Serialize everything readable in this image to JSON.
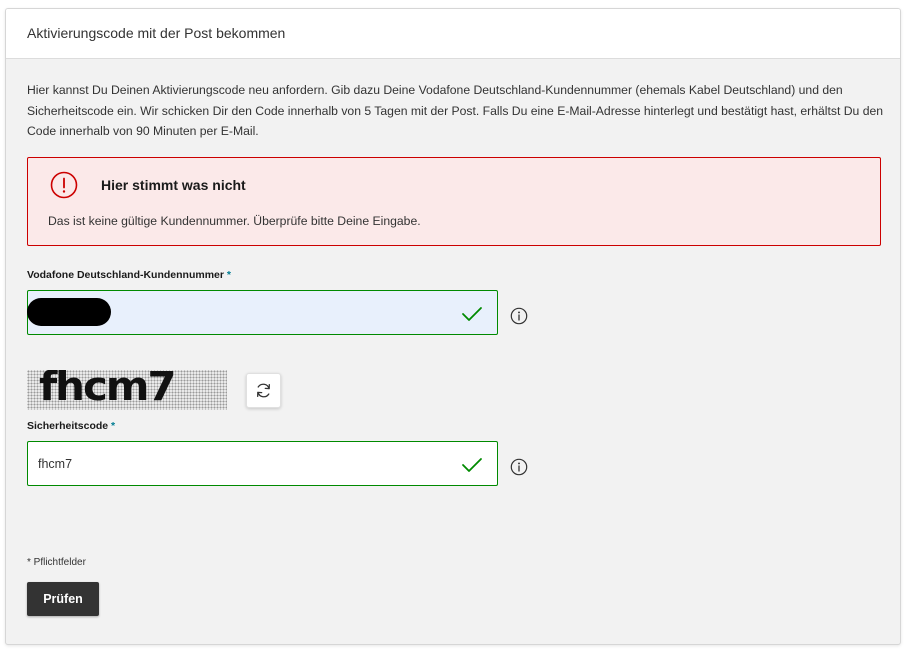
{
  "card": {
    "title": "Aktivierungscode mit der Post bekommen",
    "intro": "Hier kannst Du Deinen Aktivierungscode neu anfordern. Gib dazu Deine Vodafone Deutschland-Kundennummer (ehemals Kabel Deutschland) und den Sicherheitscode ein. Wir schicken Dir den Code innerhalb von 5 Tagen mit der Post. Falls Du eine E-Mail-Adresse hinterlegt und bestätigt hast, erhältst Du den Code innerhalb von 90 Minuten per E-Mail."
  },
  "error": {
    "icon": "exclamation-circle-icon",
    "title": "Hier stimmt was nicht",
    "message": "Das ist keine gültige Kundennummer. Überprüfe bitte Deine Eingabe."
  },
  "customer_number": {
    "label": "Vodafone Deutschland-Kundennummer",
    "required_marker": "*",
    "value": "",
    "status_icon": "checkmark-icon",
    "info_icon": "info-icon"
  },
  "captcha": {
    "image_text": "fhcm7",
    "refresh_icon": "refresh-icon"
  },
  "security_code": {
    "label": "Sicherheitscode",
    "required_marker": "*",
    "value": "fhcm7",
    "status_icon": "checkmark-icon",
    "info_icon": "info-icon"
  },
  "footer": {
    "required_note": "* Pflichtfelder",
    "submit_label": "Prüfen"
  },
  "colors": {
    "error_red": "#cc0000",
    "error_bg": "#fbe9e9",
    "success_green": "#008a00",
    "required_teal": "#007c92",
    "button_dark": "#333333"
  }
}
